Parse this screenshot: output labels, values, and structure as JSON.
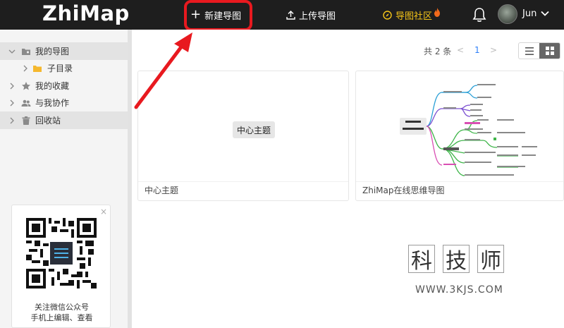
{
  "header": {
    "logo": "ZhiMap",
    "new_map": "新建导图",
    "upload_map": "上传导图",
    "community": "导图社区",
    "username": "Jun"
  },
  "sidebar": {
    "items": [
      {
        "label": "我的导图",
        "icon": "folder-user-icon",
        "active": true
      },
      {
        "label": "子目录",
        "icon": "folder-icon",
        "child": true
      },
      {
        "label": "我的收藏",
        "icon": "star-icon"
      },
      {
        "label": "与我协作",
        "icon": "people-icon"
      },
      {
        "label": "回收站",
        "icon": "trash-icon"
      }
    ],
    "qr_line1": "关注微信公众号",
    "qr_line2": "手机上编辑、查看",
    "qr_close": "×"
  },
  "main": {
    "count_text": "共 2 条",
    "page_prev": "<",
    "page": "1",
    "page_next": ">",
    "cards": [
      {
        "title": "中心主题",
        "center_text": "中心主题"
      },
      {
        "title": "ZhiMap在线思维导图"
      }
    ]
  },
  "watermark": {
    "chars": [
      "科",
      "技",
      "师"
    ],
    "url": "WWW.3KJS.COM"
  },
  "colors": {
    "header_bg": "#1e1e1e",
    "accent_blue": "#2d7ff9",
    "highlight_red": "#e8191f",
    "community_yellow": "#f5c518"
  }
}
